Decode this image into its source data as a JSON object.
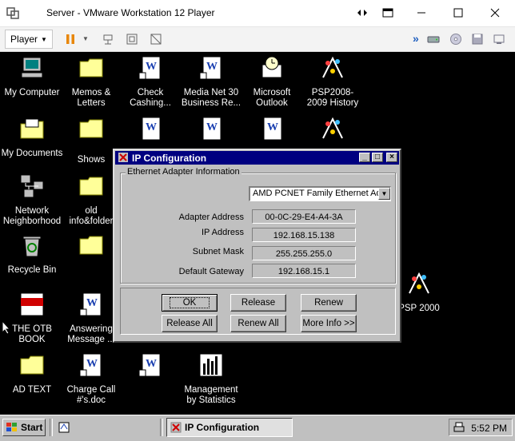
{
  "host": {
    "title": "Server - VMware Workstation 12 Player",
    "player_menu": "Player"
  },
  "desktop": {
    "icons": [
      {
        "label": "My Computer"
      },
      {
        "label": "Memos &\nLetters"
      },
      {
        "label": "Check\nCashing..."
      },
      {
        "label": "Media Net 30\nBusiness Re..."
      },
      {
        "label": "Microsoft\nOutlook"
      },
      {
        "label": "PSP2008-\n2009 History"
      },
      {
        "label": "My Documents"
      },
      {
        "label": "Shows"
      },
      {
        "label": "Network\nNeighborhood"
      },
      {
        "label": "old\ninfo&folder"
      },
      {
        "label": "Recycle Bin"
      },
      {
        "label": "THE OTB\nBOOK"
      },
      {
        "label": "Answering\nMessage ..."
      },
      {
        "label": "AD TEXT"
      },
      {
        "label": "Charge Call\n#'s.doc"
      },
      {
        "label": "Management\nby Statistics"
      },
      {
        "label": "PSP 2000"
      }
    ]
  },
  "dialog": {
    "title": "IP Configuration",
    "group_label": "Ethernet  Adapter Information",
    "adapter": "AMD PCNET Family Ethernet Ada",
    "rows": [
      {
        "label": "Adapter Address",
        "value": "00-0C-29-E4-A4-3A"
      },
      {
        "label": "IP Address",
        "value": "192.168.15.138"
      },
      {
        "label": "Subnet Mask",
        "value": "255.255.255.0"
      },
      {
        "label": "Default Gateway",
        "value": "192.168.15.1"
      }
    ],
    "buttons": {
      "ok": "OK",
      "release": "Release",
      "renew": "Renew",
      "release_all": "Release All",
      "renew_all": "Renew All",
      "more_info": "More Info >>"
    }
  },
  "taskbar": {
    "start": "Start",
    "task": "IP Configuration",
    "clock": "5:52 PM"
  }
}
